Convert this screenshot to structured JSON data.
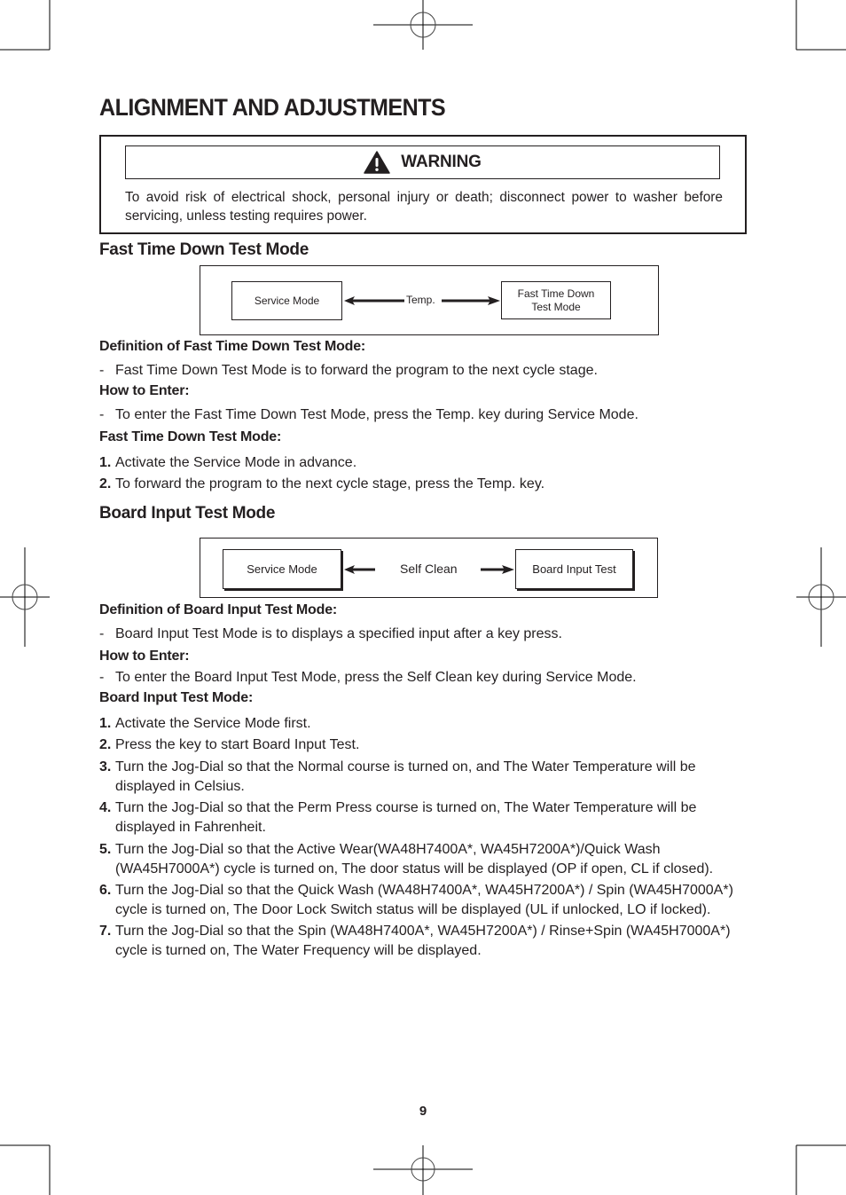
{
  "page": {
    "title": "ALIGNMENT AND ADJUSTMENTS",
    "page_number": "9"
  },
  "warning": {
    "icon": "warning-triangle-icon",
    "label": "WARNING",
    "text": "To avoid risk of electrical shock, personal injury or death; disconnect power to washer before servicing, unless testing requires power."
  },
  "fast_time_down": {
    "heading": "Fast Time Down Test Mode",
    "diagram": {
      "left_node": "Service Mode",
      "key": "Temp.",
      "right_node_line1": "Fast Time Down",
      "right_node_line2": "Test Mode"
    },
    "definition_heading": "Definition of Fast Time Down Test Mode:",
    "definition_items": [
      "Fast Time Down Test Mode is to forward the program to the next cycle stage."
    ],
    "how_to_enter_heading": "How to Enter:",
    "how_to_enter_items": [
      "To enter the Fast Time Down Test Mode, press the Temp. key during Service Mode."
    ],
    "procedure_heading": "Fast Time Down Test Mode:",
    "steps": [
      {
        "num": "1.",
        "text": "Activate the Service Mode in advance."
      },
      {
        "num": "2.",
        "text": "To forward the program to the next cycle stage, press the Temp. key."
      }
    ]
  },
  "board_input": {
    "heading": "Board Input Test Mode",
    "diagram": {
      "left_node": "Service Mode",
      "key": "Self Clean",
      "right_node": "Board Input Test"
    },
    "definition_heading": "Definition of Board Input Test Mode:",
    "definition_items": [
      "Board Input Test Mode is to displays a specified input after a key press."
    ],
    "how_to_enter_heading": "How to Enter:",
    "how_to_enter_items": [
      "To enter the Board Input Test Mode, press the Self Clean key during Service Mode."
    ],
    "procedure_heading": "Board Input Test Mode:",
    "steps": [
      {
        "num": "1.",
        "text": "Activate the Service Mode first."
      },
      {
        "num": "2.",
        "text": "Press the key to start Board Input Test."
      },
      {
        "num": "3.",
        "text": "Turn the Jog-Dial so that the Normal course is turned on, and The Water Temperature will be displayed in Celsius."
      },
      {
        "num": "4.",
        "text": "Turn the Jog-Dial so that the Perm Press course is turned on, The Water Temperature will be displayed in Fahrenheit."
      },
      {
        "num": "5.",
        "text": "Turn the Jog-Dial so that the Active Wear(WA48H7400A*, WA45H7200A*)/Quick Wash (WA45H7000A*) cycle is turned on, The door status will be displayed (OP if open, CL if closed)."
      },
      {
        "num": "6.",
        "text": "Turn the Jog-Dial so that the Quick Wash (WA48H7400A*, WA45H7200A*) / Spin (WA45H7000A*) cycle is turned on, The Door Lock Switch status will be displayed (UL if unlocked, LO if locked)."
      },
      {
        "num": "7.",
        "text": "Turn the Jog-Dial so that the Spin (WA48H7400A*, WA45H7200A*) / Rinse+Spin (WA45H7000A*) cycle is turned on, The Water Frequency will be displayed."
      }
    ]
  },
  "colors": {
    "ink": "#231f20",
    "paper": "#ffffff"
  }
}
